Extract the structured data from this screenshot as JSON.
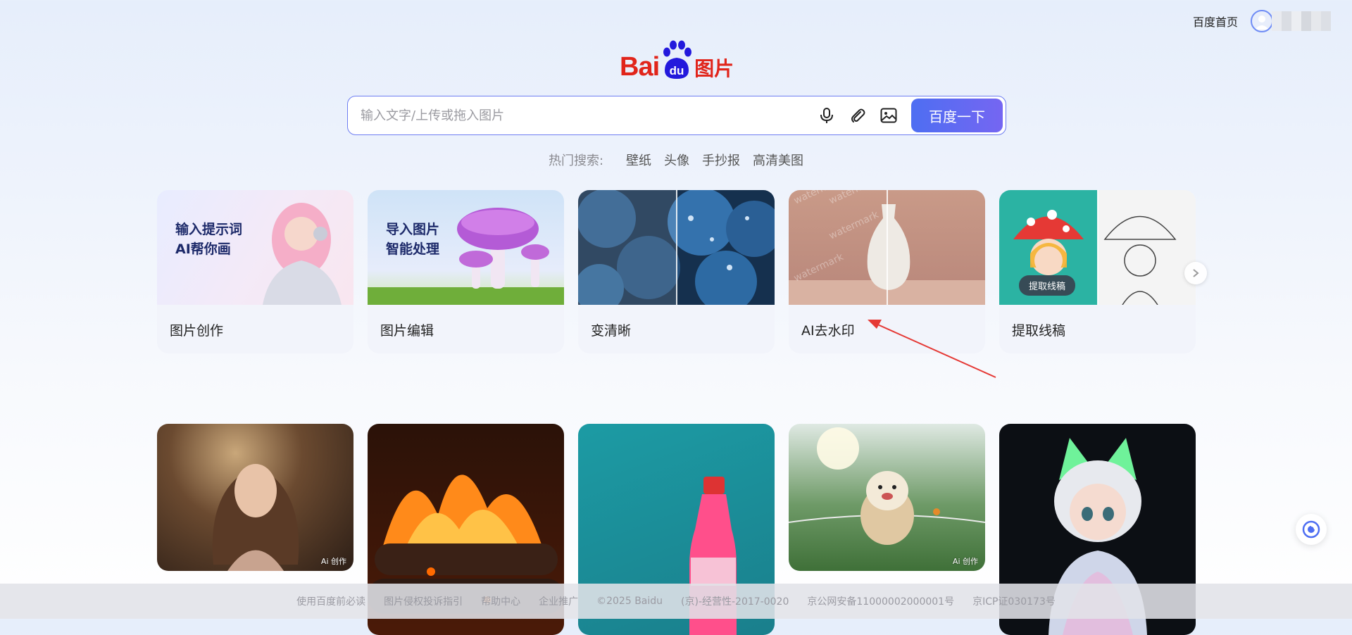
{
  "topbar": {
    "home_link": "百度首页"
  },
  "logo": {
    "text_bai": "Bai",
    "text_du": "du",
    "text_suffix": "图片"
  },
  "search": {
    "placeholder": "输入文字/上传或拖入图片",
    "button_label": "百度一下",
    "icons": [
      "microphone-icon",
      "paperclip-icon",
      "image-icon"
    ]
  },
  "hot_search": {
    "label": "热门搜索:",
    "items": [
      "壁纸",
      "头像",
      "手抄报",
      "高清美图"
    ]
  },
  "tools": [
    {
      "label": "图片创作",
      "overlay": [
        "输入提示词",
        "AI帮你画"
      ]
    },
    {
      "label": "图片编辑",
      "overlay": [
        "导入图片",
        "智能处理"
      ]
    },
    {
      "label": "变清晰"
    },
    {
      "label": "AI去水印",
      "watermark": "watermark"
    },
    {
      "label": "提取线稿",
      "pill": "提取线稿"
    }
  ],
  "gallery": [
    {
      "badge": "Ai 创作"
    },
    {
      "badge": ""
    },
    {
      "badge": ""
    },
    {
      "badge": "Ai 创作"
    },
    {
      "badge": ""
    }
  ],
  "footer": {
    "links": [
      "使用百度前必读",
      "图片侵权投诉指引",
      "帮助中心",
      "企业推广",
      "©2025 Baidu",
      "(京)-经营性-2017-0020",
      "京公网安备11000002000001号",
      "京ICP证030173号"
    ]
  },
  "colors": {
    "brand_red": "#e1251b",
    "brand_blue": "#2319dc",
    "accent": "#4e6ef2",
    "annotation_arrow": "#e53935"
  }
}
